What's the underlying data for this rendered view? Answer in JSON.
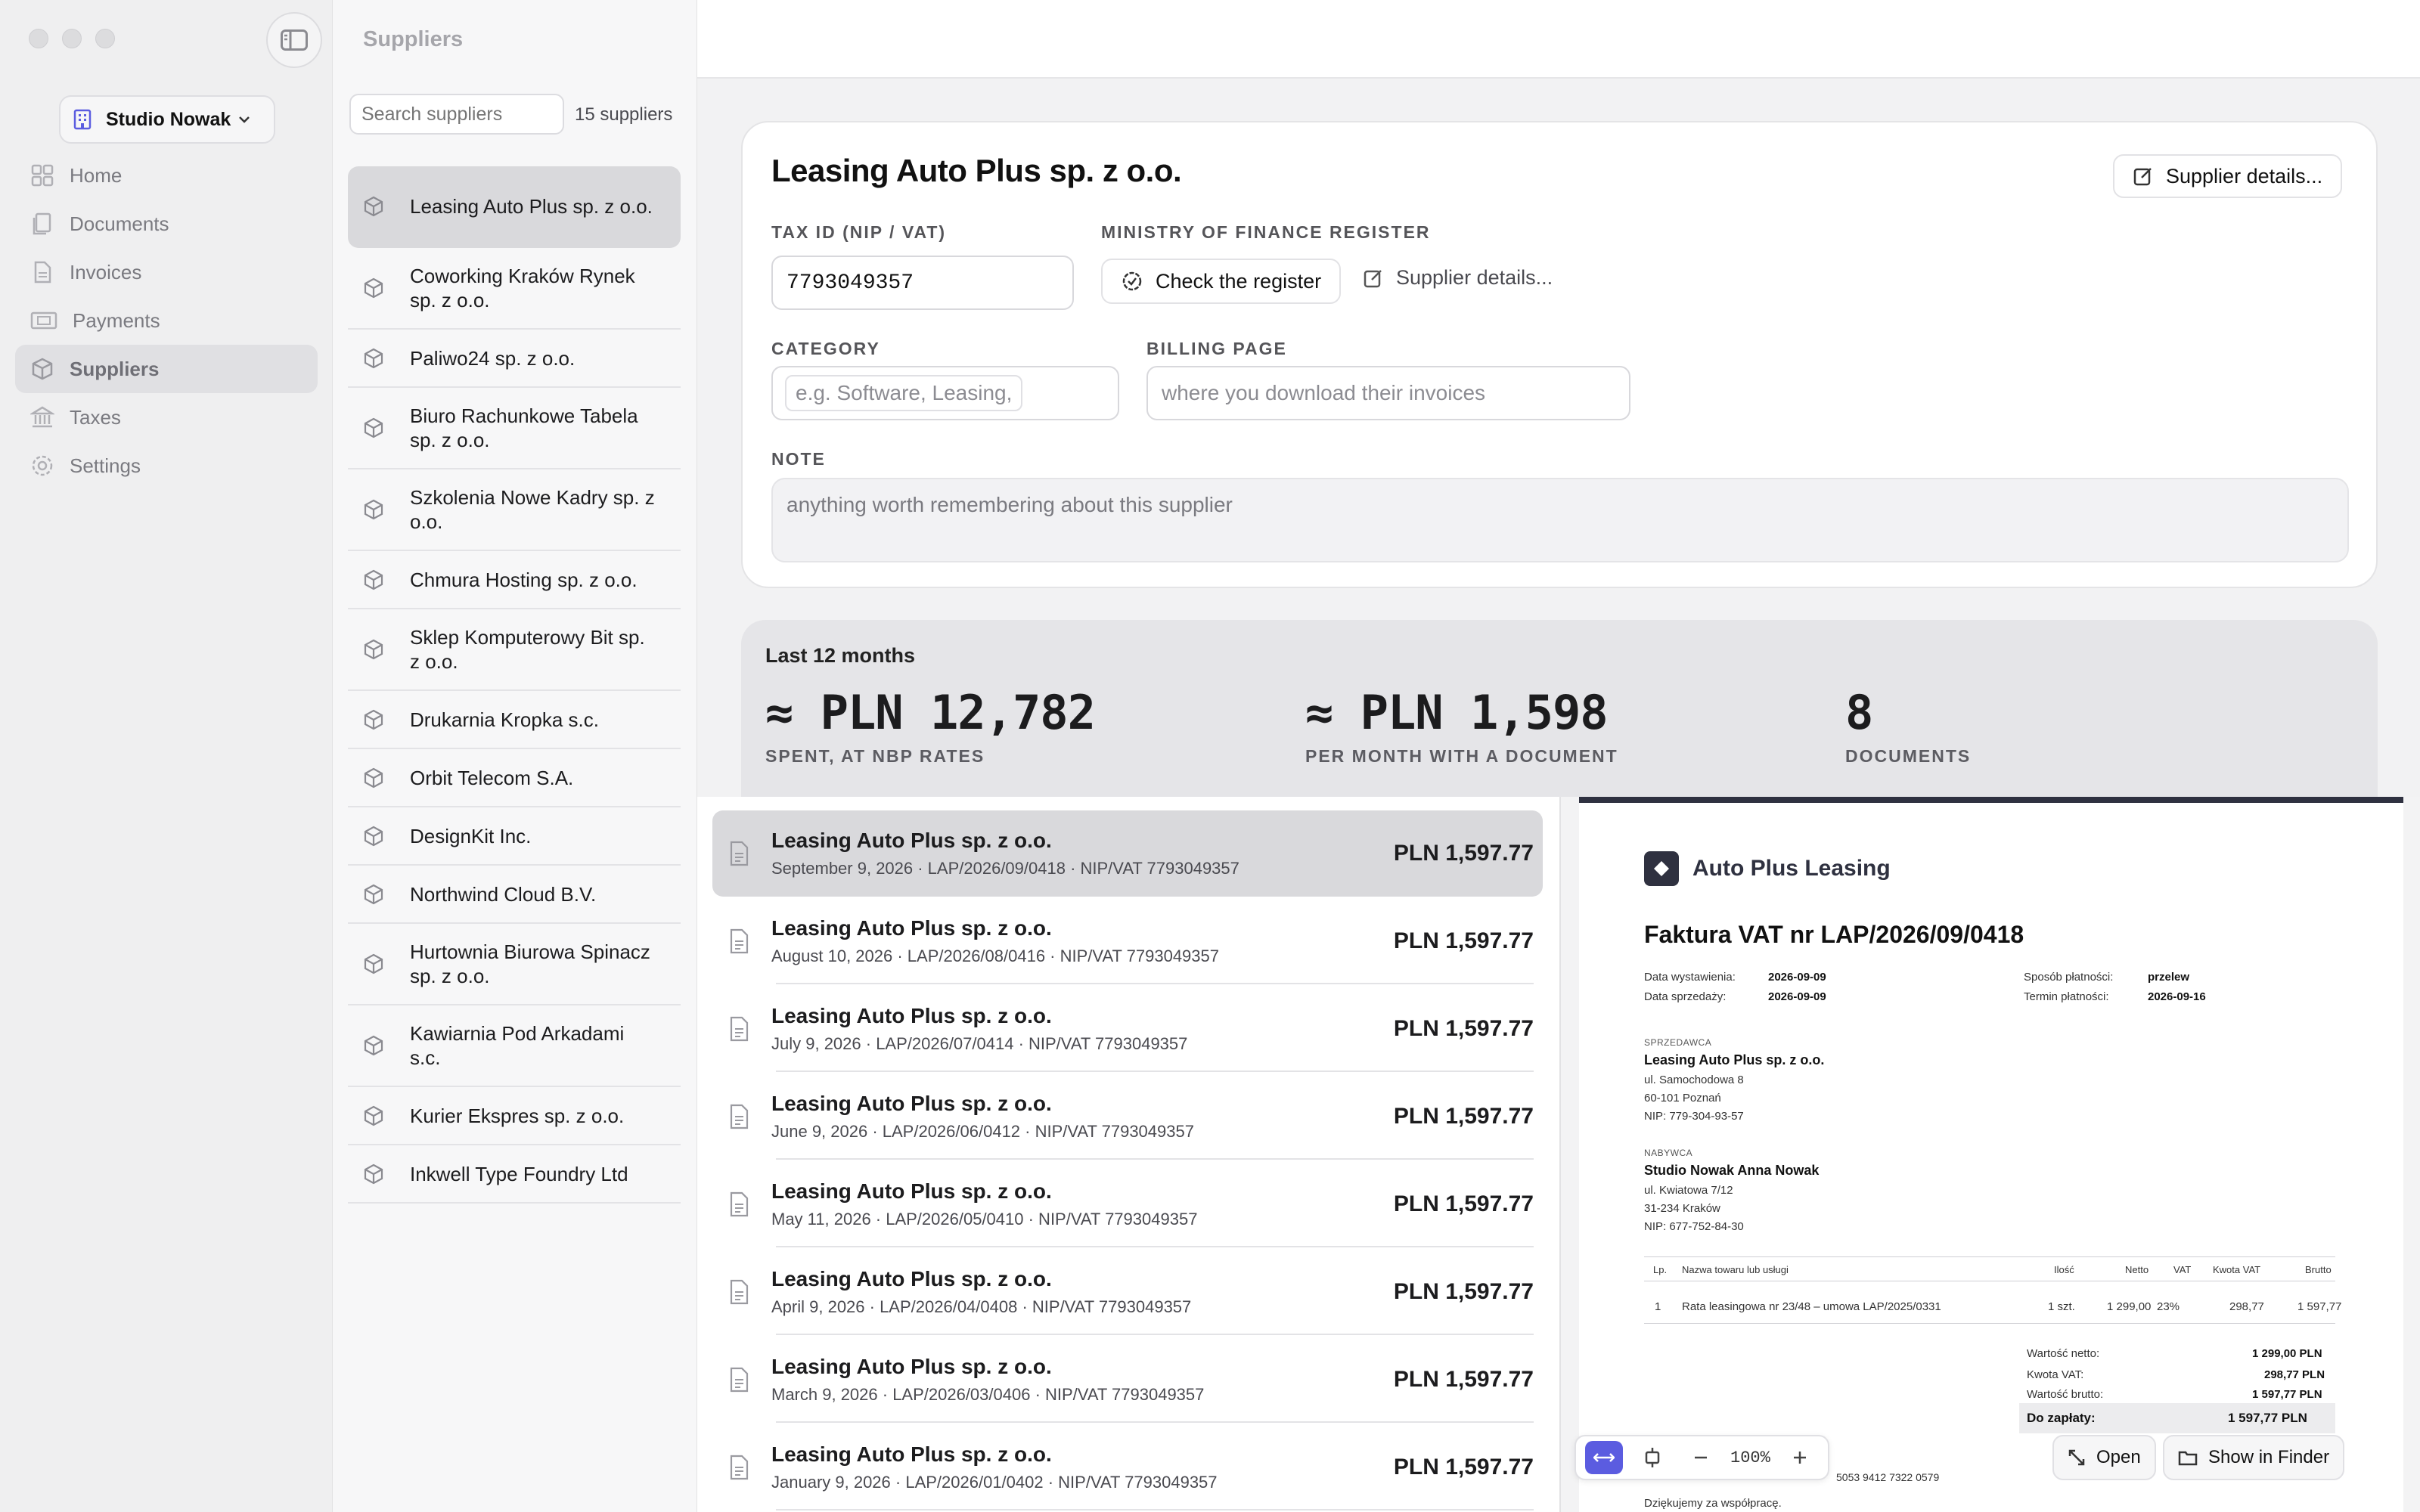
{
  "sidebar": {
    "org_name": "Studio Nowak",
    "items": [
      {
        "label": "Home",
        "icon": "home-icon"
      },
      {
        "label": "Documents",
        "icon": "documents-icon"
      },
      {
        "label": "Invoices",
        "icon": "invoice-icon"
      },
      {
        "label": "Payments",
        "icon": "payments-icon"
      },
      {
        "label": "Suppliers",
        "icon": "suppliers-icon",
        "active": true
      },
      {
        "label": "Taxes",
        "icon": "taxes-icon"
      },
      {
        "label": "Settings",
        "icon": "gear-icon"
      }
    ]
  },
  "suppliers_pane": {
    "title": "Suppliers",
    "search_placeholder": "Search suppliers",
    "count": "15 suppliers",
    "items": [
      "Leasing Auto Plus sp. z o.o.",
      "Coworking Kraków Rynek sp. z o.o.",
      "Paliwo24 sp. z o.o.",
      "Biuro Rachunkowe Tabela sp. z o.o.",
      "Szkolenia Nowe Kadry sp. z o.o.",
      "Chmura Hosting sp. z o.o.",
      "Sklep Komputerowy Bit sp. z o.o.",
      "Drukarnia Kropka s.c.",
      "Orbit Telecom S.A.",
      "DesignKit Inc.",
      "Northwind Cloud B.V.",
      "Hurtownia Biurowa Spinacz sp. z o.o.",
      "Kawiarnia Pod Arkadami s.c.",
      "Kurier Ekspres sp. z o.o.",
      "Inkwell Type Foundry Ltd"
    ]
  },
  "detail": {
    "title": "Leasing Auto Plus sp. z o.o.",
    "details_button": "Supplier details...",
    "tax_id_label": "TAX ID (NIP / VAT)",
    "tax_id_value": "7793049357",
    "register_label": "MINISTRY OF FINANCE REGISTER",
    "check_register": "Check the register",
    "details_link": "Supplier details...",
    "category_label": "CATEGORY",
    "category_placeholder": "e.g. Software, Leasing,",
    "billing_label": "BILLING PAGE",
    "billing_placeholder": "where you download their invoices",
    "note_label": "NOTE",
    "note_placeholder": "anything worth remembering about this supplier"
  },
  "stats": {
    "period": "Last 12 months",
    "spent_value": "≈ PLN 12,782",
    "spent_caption": "SPENT, AT NBP RATES",
    "monthly_value": "≈ PLN 1,598",
    "monthly_caption": "PER MONTH WITH A DOCUMENT",
    "docs_value": "8",
    "docs_caption": "DOCUMENTS"
  },
  "documents": [
    {
      "supplier": "Leasing Auto Plus sp. z o.o.",
      "meta": "September 9, 2026  ·  LAP/2026/09/0418  ·  NIP/VAT 7793049357",
      "amount": "PLN 1,597.77"
    },
    {
      "supplier": "Leasing Auto Plus sp. z o.o.",
      "meta": "August 10, 2026  ·  LAP/2026/08/0416  ·  NIP/VAT 7793049357",
      "amount": "PLN 1,597.77"
    },
    {
      "supplier": "Leasing Auto Plus sp. z o.o.",
      "meta": "July 9, 2026  ·  LAP/2026/07/0414  ·  NIP/VAT 7793049357",
      "amount": "PLN 1,597.77"
    },
    {
      "supplier": "Leasing Auto Plus sp. z o.o.",
      "meta": "June 9, 2026  ·  LAP/2026/06/0412  ·  NIP/VAT 7793049357",
      "amount": "PLN 1,597.77"
    },
    {
      "supplier": "Leasing Auto Plus sp. z o.o.",
      "meta": "May 11, 2026  ·  LAP/2026/05/0410  ·  NIP/VAT 7793049357",
      "amount": "PLN 1,597.77"
    },
    {
      "supplier": "Leasing Auto Plus sp. z o.o.",
      "meta": "April 9, 2026  ·  LAP/2026/04/0408  ·  NIP/VAT 7793049357",
      "amount": "PLN 1,597.77"
    },
    {
      "supplier": "Leasing Auto Plus sp. z o.o.",
      "meta": "March 9, 2026  ·  LAP/2026/03/0406  ·  NIP/VAT 7793049357",
      "amount": "PLN 1,597.77"
    },
    {
      "supplier": "Leasing Auto Plus sp. z o.o.",
      "meta": "January 9, 2026  ·  LAP/2026/01/0402  ·  NIP/VAT 7793049357",
      "amount": "PLN 1,597.77"
    }
  ],
  "invoice": {
    "brand": "Auto Plus Leasing",
    "title": "Faktura VAT nr LAP/2026/09/0418",
    "issue_label": "Data wystawienia:",
    "issue_date": "2026-09-09",
    "sale_label": "Data sprzedaży:",
    "sale_date": "2026-09-09",
    "pay_method_label": "Sposób płatności:",
    "pay_method": "przelew",
    "due_label": "Termin płatności:",
    "due_date": "2026-09-16",
    "seller_header": "SPRZEDAWCA",
    "seller_name": "Leasing Auto Plus sp. z o.o.",
    "seller_street": "ul. Samochodowa 8",
    "seller_city": "60-101 Poznań",
    "seller_nip": "NIP: 779-304-93-57",
    "buyer_header": "NABYWCA",
    "buyer_name": "Studio Nowak Anna Nowak",
    "buyer_street": "ul. Kwiatowa 7/12",
    "buyer_city": "31-234 Kraków",
    "buyer_nip": "NIP: 677-752-84-30",
    "col_lp": "Lp.",
    "col_name": "Nazwa towaru lub usługi",
    "col_qty": "Ilość",
    "col_net": "Netto",
    "col_vat": "VAT",
    "col_vat_amt": "Kwota VAT",
    "col_gross": "Brutto",
    "row_lp": "1",
    "row_name": "Rata leasingowa nr 23/48 – umowa LAP/2025/0331",
    "row_qty": "1 szt.",
    "row_net": "1 299,00",
    "row_vat": "23%",
    "row_vat_amt": "298,77",
    "row_gross": "1 597,77",
    "net_label": "Wartość netto:",
    "net_value": "1 299,00 PLN",
    "vat_label": "Kwota VAT:",
    "vat_value": "298,77 PLN",
    "gross_label": "Wartość brutto:",
    "gross_value": "1 597,77 PLN",
    "pay_label": "Do zapłaty:",
    "pay_value": "1 597,77 PLN",
    "account": "5053 9412 7322 0579",
    "thanks": "Dziękujemy za współpracę."
  },
  "viewer": {
    "zoom": "100%",
    "open_label": "Open",
    "finder_label": "Show in Finder"
  },
  "colors": {
    "accent": "#5b5ce0",
    "invoice_brand": "#2f3140"
  }
}
